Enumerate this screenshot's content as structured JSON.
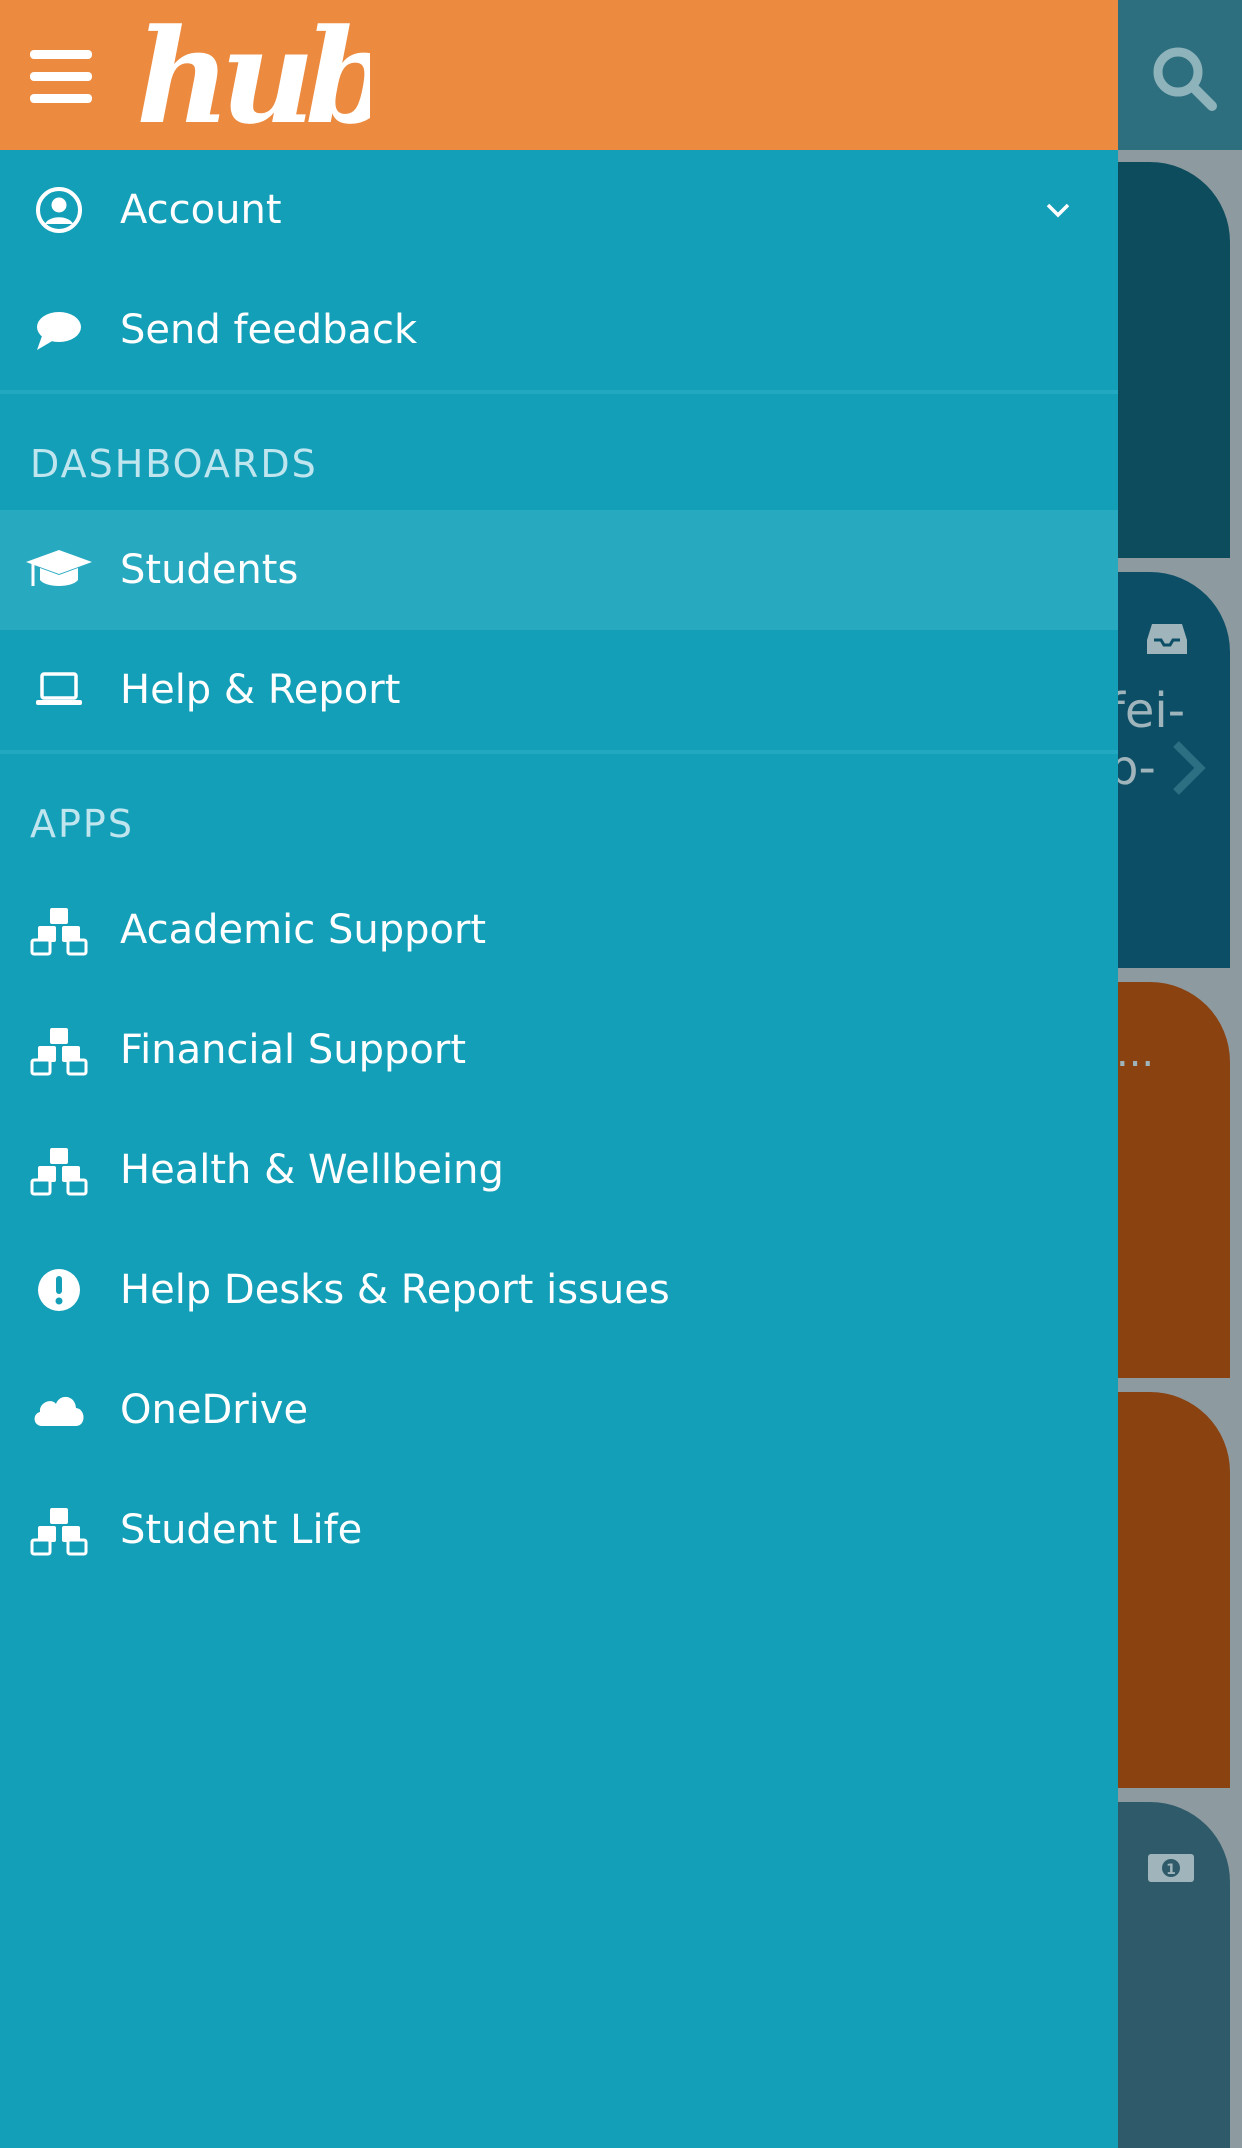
{
  "colors": {
    "header": "#ec8a3f",
    "drawer": "#149fb8",
    "active_row": "#27a9c0",
    "section_text": "#bfe5ee"
  },
  "header": {
    "logo_text": "hub"
  },
  "menu": {
    "account": {
      "label": "Account",
      "icon": "user-circle-icon"
    },
    "feedback": {
      "label": "Send feedback",
      "icon": "speech-bubble-icon"
    }
  },
  "dashboards": {
    "title": "DASHBOARDS",
    "items": [
      {
        "label": "Students",
        "icon": "graduation-cap-icon",
        "active": true
      },
      {
        "label": "Help & Report",
        "icon": "laptop-icon"
      }
    ]
  },
  "apps": {
    "title": "APPS",
    "items": [
      {
        "label": "Academic Support",
        "icon": "cubes-icon"
      },
      {
        "label": "Financial Support",
        "icon": "cubes-icon"
      },
      {
        "label": "Health & Wellbeing",
        "icon": "cubes-icon"
      },
      {
        "label": "Help Desks & Report issues",
        "icon": "exclamation-circle-icon"
      },
      {
        "label": "OneDrive",
        "icon": "cloud-icon"
      },
      {
        "label": "Student Life",
        "icon": "cubes-icon"
      }
    ]
  },
  "background": {
    "fragment_1": "fei-",
    "fragment_2": "b-",
    "fragment_3": "..."
  }
}
